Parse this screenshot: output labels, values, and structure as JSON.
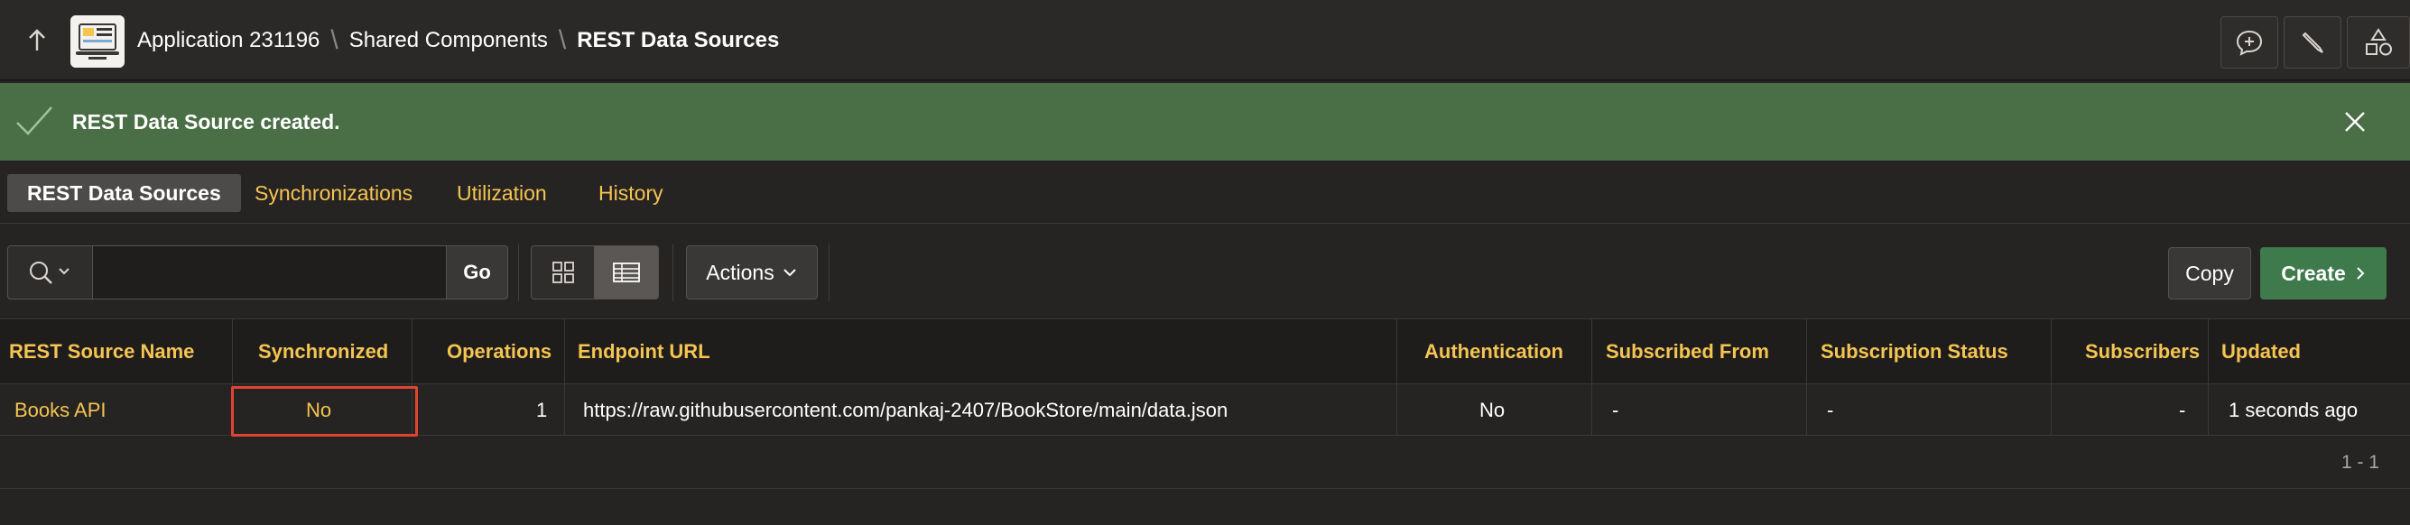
{
  "header": {
    "breadcrumbs": [
      "Application 231196",
      "Shared Components",
      "REST Data Sources"
    ],
    "separator": "\\"
  },
  "banner": {
    "message": "REST Data Source created.",
    "color": "#4a6e45"
  },
  "tabs": [
    {
      "label": "REST Data Sources",
      "active": true
    },
    {
      "label": "Synchronizations",
      "active": false
    },
    {
      "label": "Utilization",
      "active": false
    },
    {
      "label": "History",
      "active": false
    }
  ],
  "toolbar": {
    "search_value": "",
    "go_label": "Go",
    "actions_label": "Actions",
    "copy_label": "Copy",
    "create_label": "Create"
  },
  "table": {
    "columns": [
      "REST Source Name",
      "Synchronized",
      "Operations",
      "Endpoint URL",
      "Authentication",
      "Subscribed From",
      "Subscription Status",
      "Subscribers",
      "Updated"
    ],
    "rows": [
      {
        "name": "Books API",
        "synchronized": "No",
        "operations": "1",
        "endpoint": "https://raw.githubusercontent.com/pankaj-2407/BookStore/main/data.json",
        "authentication": "No",
        "subscribed_from": "-",
        "subscription_status": "-",
        "subscribers": "-",
        "updated": "1 seconds ago"
      }
    ],
    "pagination": "1 - 1"
  },
  "colors": {
    "accent": "#f6c451",
    "create_button": "#3e7a4b",
    "highlight_box": "#e0442f"
  },
  "icons": [
    "up-arrow-icon",
    "app-logo-icon",
    "feedback-icon",
    "pencil-icon",
    "shapes-icon",
    "check-icon",
    "close-icon",
    "search-icon",
    "chevron-down-icon",
    "icon-view-icon",
    "report-view-icon",
    "chevron-right-icon"
  ]
}
